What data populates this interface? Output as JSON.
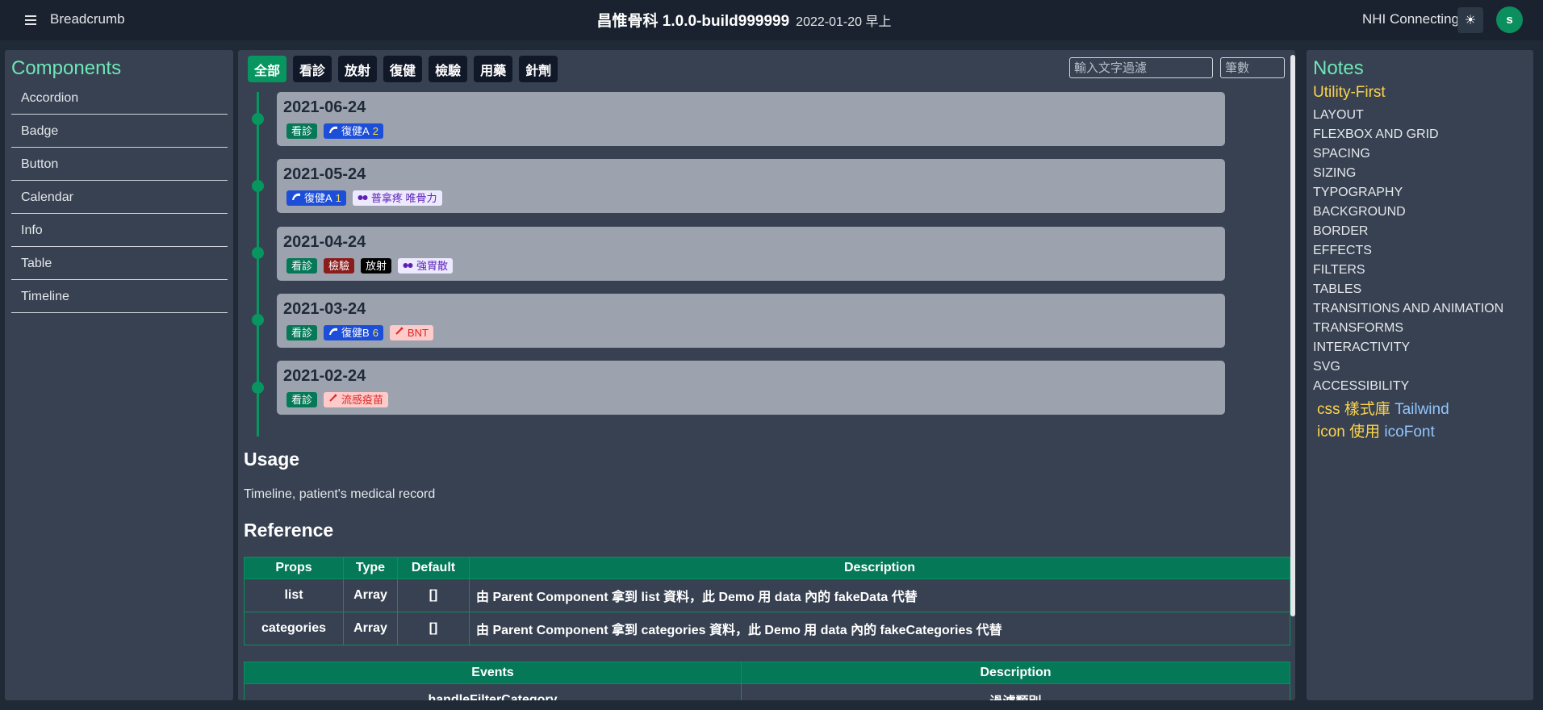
{
  "header": {
    "breadcrumb": "Breadcrumb",
    "title": "昌惟骨科 1.0.0-build999999",
    "datetime": "2022-01-20 早上",
    "nhi_status": "NHI Connecting",
    "theme_icon": "☀",
    "avatar_initial": "s"
  },
  "sidebar": {
    "title": "Components",
    "items": [
      {
        "label": "Accordion"
      },
      {
        "label": "Badge"
      },
      {
        "label": "Button"
      },
      {
        "label": "Calendar"
      },
      {
        "label": "Info"
      },
      {
        "label": "Table"
      },
      {
        "label": "Timeline"
      }
    ]
  },
  "filters": {
    "categories": [
      {
        "label": "全部",
        "active": true
      },
      {
        "label": "看診"
      },
      {
        "label": "放射"
      },
      {
        "label": "復健"
      },
      {
        "label": "檢驗"
      },
      {
        "label": "用藥"
      },
      {
        "label": "針劑"
      }
    ],
    "text_placeholder": "輸入文字過濾",
    "count_placeholder": "筆數"
  },
  "timeline": [
    {
      "date": "2021-06-24",
      "badges": [
        {
          "type": "visit",
          "text": "看診"
        },
        {
          "type": "rehab",
          "icon": "rehab-icon",
          "text": "復健A",
          "num": "2"
        }
      ]
    },
    {
      "date": "2021-05-24",
      "badges": [
        {
          "type": "rehab",
          "icon": "rehab-icon",
          "text": "復健A",
          "num": "1"
        },
        {
          "type": "med",
          "icon": "pill-icon",
          "text": "普拿疼  唯骨力"
        }
      ]
    },
    {
      "date": "2021-04-24",
      "badges": [
        {
          "type": "visit",
          "text": "看診"
        },
        {
          "type": "lab",
          "text": "檢驗"
        },
        {
          "type": "xray",
          "text": "放射"
        },
        {
          "type": "med",
          "icon": "pill-icon",
          "text": "強胃散"
        }
      ]
    },
    {
      "date": "2021-03-24",
      "badges": [
        {
          "type": "visit",
          "text": "看診"
        },
        {
          "type": "rehab",
          "icon": "rehab-icon",
          "text": "復健B",
          "num": "6"
        },
        {
          "type": "inj",
          "icon": "syringe-icon",
          "text": "BNT"
        }
      ]
    },
    {
      "date": "2021-02-24",
      "badges": [
        {
          "type": "visit",
          "text": "看診"
        },
        {
          "type": "inj",
          "icon": "syringe-icon",
          "text": "流感疫苗"
        }
      ]
    }
  ],
  "usage": {
    "heading": "Usage",
    "text": "Timeline, patient's medical record"
  },
  "reference": {
    "heading": "Reference",
    "props_headers": [
      "Props",
      "Type",
      "Default",
      "Description"
    ],
    "props_rows": [
      [
        "list",
        "Array",
        "[]",
        "由 Parent Component 拿到 list 資料，此 Demo 用 data 內的 fakeData 代替"
      ],
      [
        "categories",
        "Array",
        "[]",
        "由 Parent Component 拿到 categories 資料，此 Demo 用 data 內的 fakeCategories 代替"
      ]
    ],
    "events_headers": [
      "Events",
      "Description"
    ],
    "events_rows": [
      [
        "handleFilterCategory",
        "過濾類別"
      ]
    ]
  },
  "notes": {
    "title": "Notes",
    "subtitle": "Utility-First",
    "items": [
      "LAYOUT",
      "FLEXBOX AND GRID",
      "SPACING",
      "SIZING",
      "TYPOGRAPHY",
      "BACKGROUND",
      "BORDER",
      "EFFECTS",
      "FILTERS",
      "TABLES",
      "TRANSITIONS AND ANIMATION",
      "TRANSFORMS",
      "INTERACTIVITY",
      "SVG",
      "ACCESSIBILITY"
    ],
    "css_label": "css 樣式庫",
    "css_link": "Tailwind",
    "icon_label": "icon 使用",
    "icon_link": "icoFont"
  },
  "colors": {
    "accent": "#07965f",
    "notes_title": "#6ee7b7",
    "notes_subtitle": "#fcd34d",
    "link": "#93c5fd"
  }
}
